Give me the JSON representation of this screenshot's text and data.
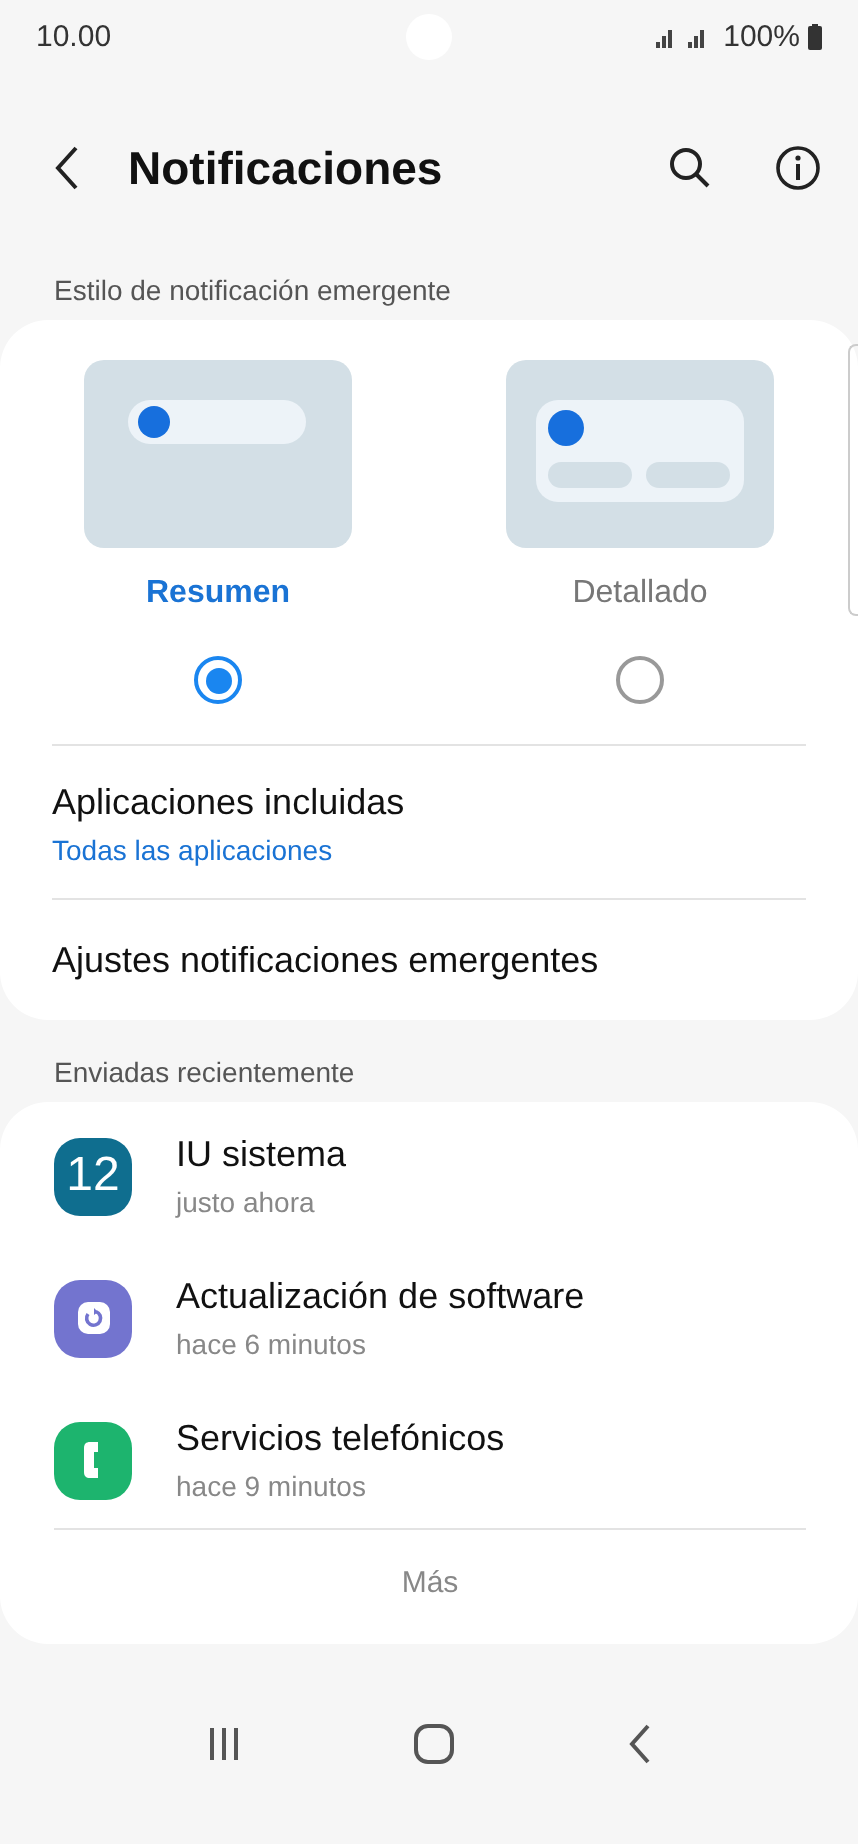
{
  "status_bar": {
    "time": "10.00",
    "battery": "100%"
  },
  "header": {
    "title": "Notificaciones"
  },
  "popup_style": {
    "label": "Estilo de notificación emergente",
    "options": [
      {
        "kind": "brief",
        "label": "Resumen",
        "selected": true
      },
      {
        "kind": "detailed",
        "label": "Detallado",
        "selected": false
      }
    ],
    "settings": [
      {
        "title": "Aplicaciones incluidas",
        "subtitle": "Todas las aplicaciones"
      },
      {
        "title": "Ajustes notificaciones emergentes"
      }
    ]
  },
  "recent": {
    "label": "Enviadas recientemente",
    "apps": [
      {
        "kind": "system",
        "name": "IU sistema",
        "time": "justo ahora",
        "icon_text": "12",
        "color": "#0f6e8f"
      },
      {
        "kind": "update",
        "name": "Actualización de software",
        "time": "hace 6 minutos",
        "color": "#7374cf"
      },
      {
        "kind": "phone",
        "name": "Servicios telefónicos",
        "time": "hace 9 minutos",
        "color": "#1db46e"
      }
    ],
    "more": "Más"
  }
}
